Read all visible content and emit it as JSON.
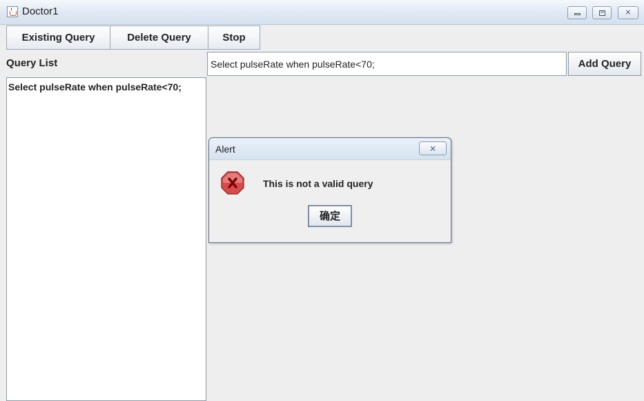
{
  "window": {
    "title": "Doctor1",
    "close_glyph": "⨯"
  },
  "toolbar": {
    "existing_query_label": "Existing Query",
    "delete_query_label": "Delete Query",
    "stop_label": "Stop"
  },
  "query_list": {
    "label": "Query List",
    "items": [
      "Select pulseRate when pulseRate<70;"
    ]
  },
  "query_input": {
    "value": "Select pulseRate when pulseRate<70;"
  },
  "add_query": {
    "label": "Add Query"
  },
  "alert": {
    "title": "Alert",
    "close_glyph": "⨯",
    "message": "This is not a valid query",
    "ok_label": "确定",
    "icon": "error-icon"
  },
  "colors": {
    "error_icon_fill": "#d94a4a",
    "error_icon_x": "#7a0000"
  }
}
